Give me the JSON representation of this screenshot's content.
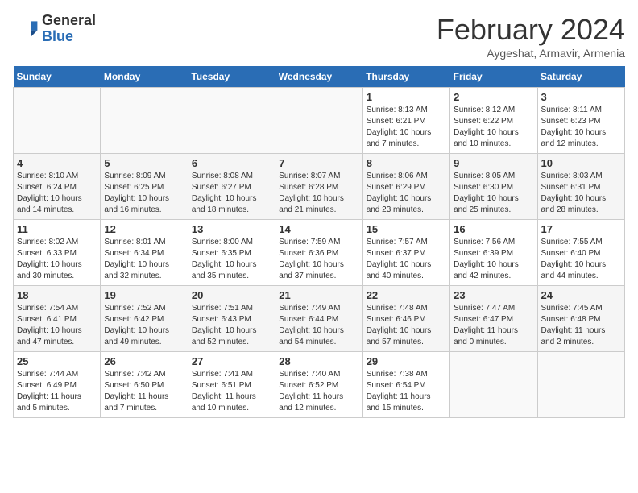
{
  "header": {
    "logo_general": "General",
    "logo_blue": "Blue",
    "month_title": "February 2024",
    "subtitle": "Aygeshat, Armavir, Armenia"
  },
  "days_of_week": [
    "Sunday",
    "Monday",
    "Tuesday",
    "Wednesday",
    "Thursday",
    "Friday",
    "Saturday"
  ],
  "weeks": [
    [
      {
        "day": "",
        "info": ""
      },
      {
        "day": "",
        "info": ""
      },
      {
        "day": "",
        "info": ""
      },
      {
        "day": "",
        "info": ""
      },
      {
        "day": "1",
        "info": "Sunrise: 8:13 AM\nSunset: 6:21 PM\nDaylight: 10 hours\nand 7 minutes."
      },
      {
        "day": "2",
        "info": "Sunrise: 8:12 AM\nSunset: 6:22 PM\nDaylight: 10 hours\nand 10 minutes."
      },
      {
        "day": "3",
        "info": "Sunrise: 8:11 AM\nSunset: 6:23 PM\nDaylight: 10 hours\nand 12 minutes."
      }
    ],
    [
      {
        "day": "4",
        "info": "Sunrise: 8:10 AM\nSunset: 6:24 PM\nDaylight: 10 hours\nand 14 minutes."
      },
      {
        "day": "5",
        "info": "Sunrise: 8:09 AM\nSunset: 6:25 PM\nDaylight: 10 hours\nand 16 minutes."
      },
      {
        "day": "6",
        "info": "Sunrise: 8:08 AM\nSunset: 6:27 PM\nDaylight: 10 hours\nand 18 minutes."
      },
      {
        "day": "7",
        "info": "Sunrise: 8:07 AM\nSunset: 6:28 PM\nDaylight: 10 hours\nand 21 minutes."
      },
      {
        "day": "8",
        "info": "Sunrise: 8:06 AM\nSunset: 6:29 PM\nDaylight: 10 hours\nand 23 minutes."
      },
      {
        "day": "9",
        "info": "Sunrise: 8:05 AM\nSunset: 6:30 PM\nDaylight: 10 hours\nand 25 minutes."
      },
      {
        "day": "10",
        "info": "Sunrise: 8:03 AM\nSunset: 6:31 PM\nDaylight: 10 hours\nand 28 minutes."
      }
    ],
    [
      {
        "day": "11",
        "info": "Sunrise: 8:02 AM\nSunset: 6:33 PM\nDaylight: 10 hours\nand 30 minutes."
      },
      {
        "day": "12",
        "info": "Sunrise: 8:01 AM\nSunset: 6:34 PM\nDaylight: 10 hours\nand 32 minutes."
      },
      {
        "day": "13",
        "info": "Sunrise: 8:00 AM\nSunset: 6:35 PM\nDaylight: 10 hours\nand 35 minutes."
      },
      {
        "day": "14",
        "info": "Sunrise: 7:59 AM\nSunset: 6:36 PM\nDaylight: 10 hours\nand 37 minutes."
      },
      {
        "day": "15",
        "info": "Sunrise: 7:57 AM\nSunset: 6:37 PM\nDaylight: 10 hours\nand 40 minutes."
      },
      {
        "day": "16",
        "info": "Sunrise: 7:56 AM\nSunset: 6:39 PM\nDaylight: 10 hours\nand 42 minutes."
      },
      {
        "day": "17",
        "info": "Sunrise: 7:55 AM\nSunset: 6:40 PM\nDaylight: 10 hours\nand 44 minutes."
      }
    ],
    [
      {
        "day": "18",
        "info": "Sunrise: 7:54 AM\nSunset: 6:41 PM\nDaylight: 10 hours\nand 47 minutes."
      },
      {
        "day": "19",
        "info": "Sunrise: 7:52 AM\nSunset: 6:42 PM\nDaylight: 10 hours\nand 49 minutes."
      },
      {
        "day": "20",
        "info": "Sunrise: 7:51 AM\nSunset: 6:43 PM\nDaylight: 10 hours\nand 52 minutes."
      },
      {
        "day": "21",
        "info": "Sunrise: 7:49 AM\nSunset: 6:44 PM\nDaylight: 10 hours\nand 54 minutes."
      },
      {
        "day": "22",
        "info": "Sunrise: 7:48 AM\nSunset: 6:46 PM\nDaylight: 10 hours\nand 57 minutes."
      },
      {
        "day": "23",
        "info": "Sunrise: 7:47 AM\nSunset: 6:47 PM\nDaylight: 11 hours\nand 0 minutes."
      },
      {
        "day": "24",
        "info": "Sunrise: 7:45 AM\nSunset: 6:48 PM\nDaylight: 11 hours\nand 2 minutes."
      }
    ],
    [
      {
        "day": "25",
        "info": "Sunrise: 7:44 AM\nSunset: 6:49 PM\nDaylight: 11 hours\nand 5 minutes."
      },
      {
        "day": "26",
        "info": "Sunrise: 7:42 AM\nSunset: 6:50 PM\nDaylight: 11 hours\nand 7 minutes."
      },
      {
        "day": "27",
        "info": "Sunrise: 7:41 AM\nSunset: 6:51 PM\nDaylight: 11 hours\nand 10 minutes."
      },
      {
        "day": "28",
        "info": "Sunrise: 7:40 AM\nSunset: 6:52 PM\nDaylight: 11 hours\nand 12 minutes."
      },
      {
        "day": "29",
        "info": "Sunrise: 7:38 AM\nSunset: 6:54 PM\nDaylight: 11 hours\nand 15 minutes."
      },
      {
        "day": "",
        "info": ""
      },
      {
        "day": "",
        "info": ""
      }
    ]
  ]
}
